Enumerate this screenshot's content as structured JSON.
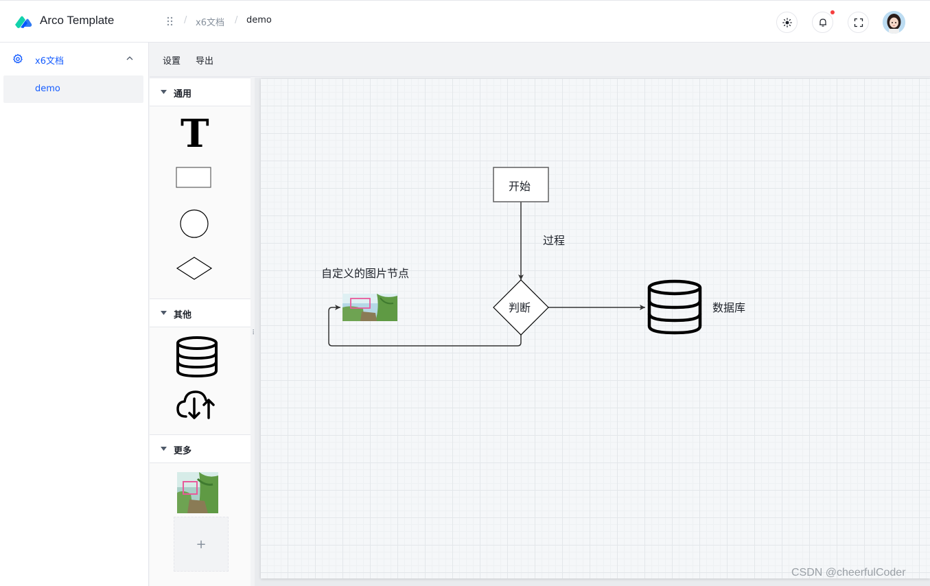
{
  "header": {
    "app_title": "Arco Template",
    "breadcrumb": [
      "x6文档",
      "demo"
    ],
    "breadcrumb_sep": "/",
    "brand_color": "#165dff",
    "notification_dot_color": "#f53f3f"
  },
  "sidebar": {
    "group_label": "x6文档",
    "group_icon": "gear-icon",
    "items": [
      {
        "label": "demo",
        "active": true
      }
    ]
  },
  "toolbar": {
    "settings_label": "设置",
    "export_label": "导出"
  },
  "stencil": {
    "groups": [
      {
        "title": "通用",
        "items": [
          "text-icon",
          "rectangle-shape",
          "circle-shape",
          "diamond-shape"
        ]
      },
      {
        "title": "其他",
        "items": [
          "database-icon",
          "cloud-sync-icon"
        ]
      },
      {
        "title": "更多",
        "items": [
          "image-thumbnail",
          "upload-add-button"
        ]
      }
    ],
    "upload_plus": "+"
  },
  "graph": {
    "nodes": {
      "start": "开始",
      "decision": "判断",
      "database": "数据库",
      "image_node": "自定义的图片节点"
    },
    "edge_label": "过程"
  },
  "watermark": "CSDN @cheerfulCoder"
}
